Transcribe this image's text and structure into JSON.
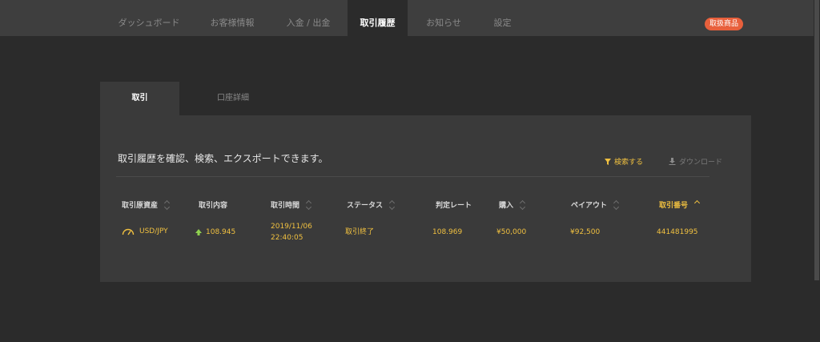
{
  "nav": {
    "tabs": [
      {
        "label": "ダッシュボード"
      },
      {
        "label": "お客様情報"
      },
      {
        "label": "入金 / 出金"
      },
      {
        "label": "取引履歴"
      },
      {
        "label": "お知らせ"
      },
      {
        "label": "設定"
      }
    ],
    "active_tab": "取引履歴",
    "badge": "取扱商品"
  },
  "subtabs": [
    {
      "label": "取引"
    },
    {
      "label": "口座詳細"
    }
  ],
  "panel": {
    "description": "取引履歴を確認、検索、エクスポートできます。",
    "search_label": "検索する",
    "download_label": "ダウンロード"
  },
  "table": {
    "columns": [
      {
        "label": "取引原資産",
        "sorted": false
      },
      {
        "label": "取引内容",
        "sorted": false
      },
      {
        "label": "取引時間",
        "sorted": false
      },
      {
        "label": "ステータス",
        "sorted": false
      },
      {
        "label": "判定レート",
        "sorted": false
      },
      {
        "label": "購入",
        "sorted": false
      },
      {
        "label": "ペイアウト",
        "sorted": false
      },
      {
        "label": "取引番号",
        "sorted": true
      }
    ],
    "rows": [
      {
        "asset": "USD/JPY",
        "direction_icon": "up-arrow-icon",
        "entry_rate": "108.945",
        "date": "2019/11/06",
        "time": "22:40:05",
        "status": "取引終了",
        "judgment_rate": "108.969",
        "purchase": "¥50,000",
        "payout": "¥92,500",
        "trade_no": "441481995"
      }
    ]
  },
  "colors": {
    "accent": "#f0c040",
    "badge": "#e8603c",
    "up": "#8fd14f"
  }
}
